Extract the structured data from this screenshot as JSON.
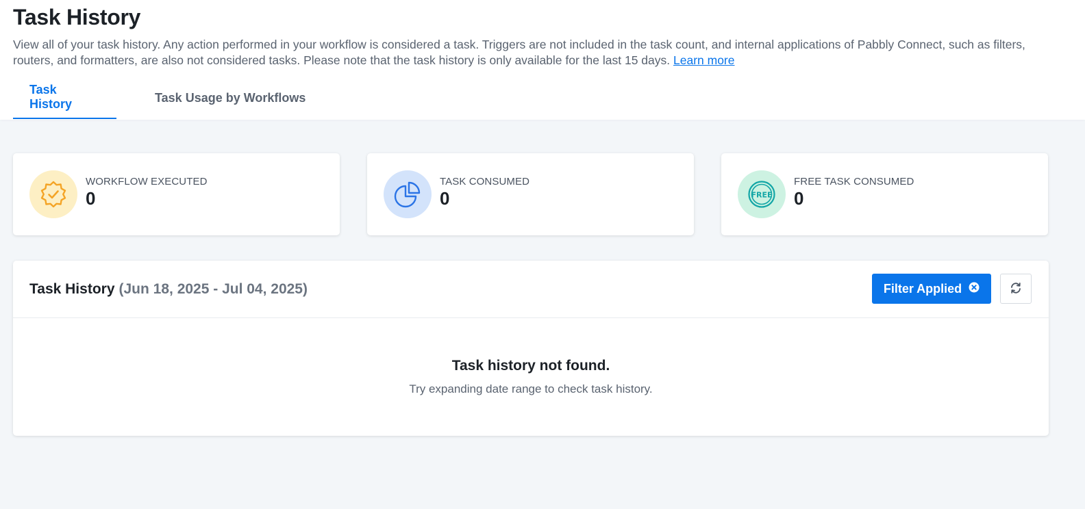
{
  "header": {
    "title": "Task History",
    "description": "View all of your task history. Any action performed in your workflow is considered a task. Triggers are not included in the task count, and internal applications of Pabbly Connect, such as filters, routers, and formatters, are also not considered tasks. Please note that the task history is only available for the last 15 days.",
    "learn_more": "Learn more"
  },
  "tabs": [
    {
      "label": "Task History",
      "active": true
    },
    {
      "label": "Task Usage by Workflows",
      "active": false
    }
  ],
  "stats": [
    {
      "label": "WORKFLOW EXECUTED",
      "value": "0",
      "icon": "badge-check-icon",
      "bg": "#fdefc4",
      "color": "#f4a426"
    },
    {
      "label": "TASK CONSUMED",
      "value": "0",
      "icon": "pie-chart-icon",
      "bg": "#d3e3fb",
      "color": "#2b74e6"
    },
    {
      "label": "FREE TASK CONSUMED",
      "value": "0",
      "icon": "free-badge-icon",
      "bg": "#cdf2e2",
      "color": "#13a6a6"
    }
  ],
  "history": {
    "title": "Task History",
    "range": "(Jun 18, 2025 - Jul 04, 2025)",
    "filter_label": "Filter Applied",
    "empty_title": "Task history not found.",
    "empty_subtitle": "Try expanding date range to check task history."
  },
  "colors": {
    "accent": "#0a75ea",
    "background": "#f3f6f9"
  }
}
